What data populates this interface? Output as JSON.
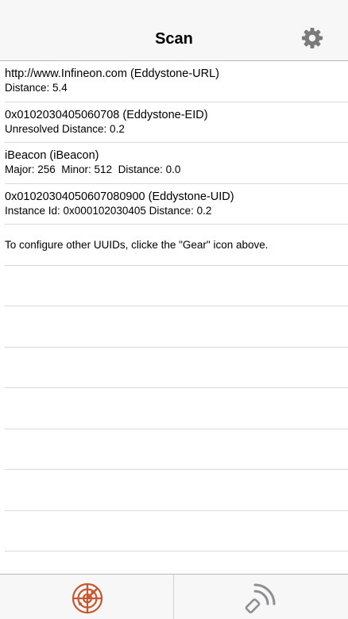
{
  "nav": {
    "title": "Scan",
    "settings_icon": "gear-icon"
  },
  "rows": [
    {
      "line1": "http://www.Infineon.com (Eddystone-URL)",
      "line2": "Distance: 5.4"
    },
    {
      "line1": "0x0102030405060708 (Eddystone-EID)",
      "line2": "Unresolved Distance: 0.2"
    },
    {
      "line1": "iBeacon (iBeacon)",
      "line2": "Major: 256  Minor: 512  Distance: 0.0"
    },
    {
      "line1": "0x01020304050607080900 (Eddystone-UID)",
      "line2": "Instance Id: 0x000102030405 Distance: 0.2"
    }
  ],
  "info_text": "To configure other UUIDs, clicke the \"Gear\" icon above.",
  "empty_rows": 7,
  "tabs": [
    {
      "icon": "radar-scan-icon",
      "active": true
    },
    {
      "icon": "broadcast-icon",
      "active": false
    }
  ],
  "colors": {
    "active_tab": "#c8562e",
    "inactive_tab": "#8e8e93",
    "gear": "#7a7a7a"
  }
}
